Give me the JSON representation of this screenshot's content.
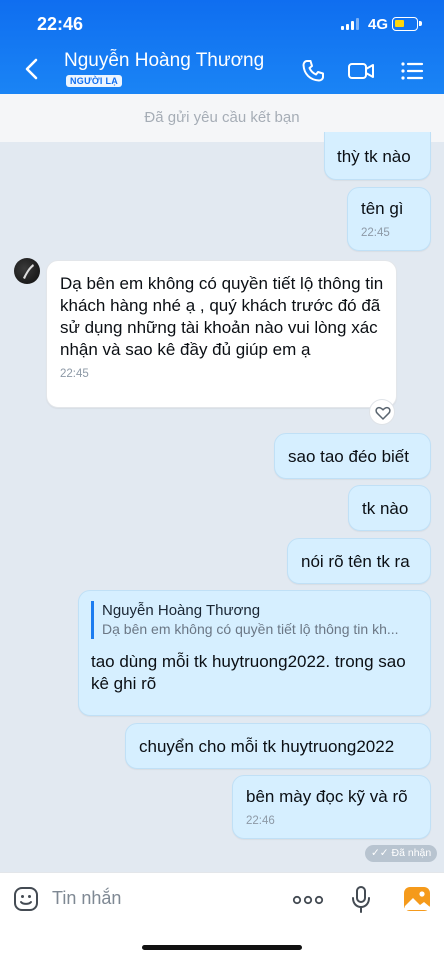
{
  "status_bar": {
    "time": "22:46",
    "network": "4G"
  },
  "header": {
    "contact_name": "Nguyễn Hoàng Thương",
    "badge": "NGƯỜI LẠ"
  },
  "banner": {
    "text": "Đã gửi yêu cầu kết bạn"
  },
  "messages": [
    {
      "from": "me",
      "text": "thỳ tk nào",
      "time": ""
    },
    {
      "from": "me",
      "text": "tên gì",
      "time": "22:45"
    },
    {
      "from": "them",
      "text": "Dạ bên em không có quyền tiết lộ thông tin khách hàng nhé ạ , quý khách trước đó đã sử dụng những tài khoản nào vui lòng xác nhận và sao kê đầy đủ giúp em ạ",
      "time": "22:45"
    },
    {
      "from": "me",
      "text": "sao tao đéo biết",
      "time": ""
    },
    {
      "from": "me",
      "text": "tk nào",
      "time": ""
    },
    {
      "from": "me",
      "text": "nói rõ tên tk ra",
      "time": ""
    },
    {
      "from": "me",
      "quote_name": "Nguyễn Hoàng Thương",
      "quote_text": "Dạ bên em không có quyền tiết lộ thông tin kh...",
      "text": "tao dùng mỗi tk huytruong2022.  trong sao kê ghi rõ",
      "time": ""
    },
    {
      "from": "me",
      "text": "chuyển cho mỗi tk huytruong2022",
      "time": ""
    },
    {
      "from": "me",
      "text": "bên mày đọc kỹ và rõ",
      "time": "22:46"
    }
  ],
  "delivery_status": "Đã nhận",
  "input": {
    "placeholder": "Tin nhắn"
  },
  "colors": {
    "header": "#1a84f5",
    "my_bubble": "#d6efff",
    "their_bubble": "#ffffff",
    "chat_bg": "#e2e9f1"
  },
  "icons": [
    "back-arrow-icon",
    "phone-icon",
    "video-call-icon",
    "menu-list-icon",
    "sticker-icon",
    "more-dots-icon",
    "microphone-icon",
    "image-gallery-icon",
    "heart-reaction-icon",
    "double-check-icon"
  ]
}
